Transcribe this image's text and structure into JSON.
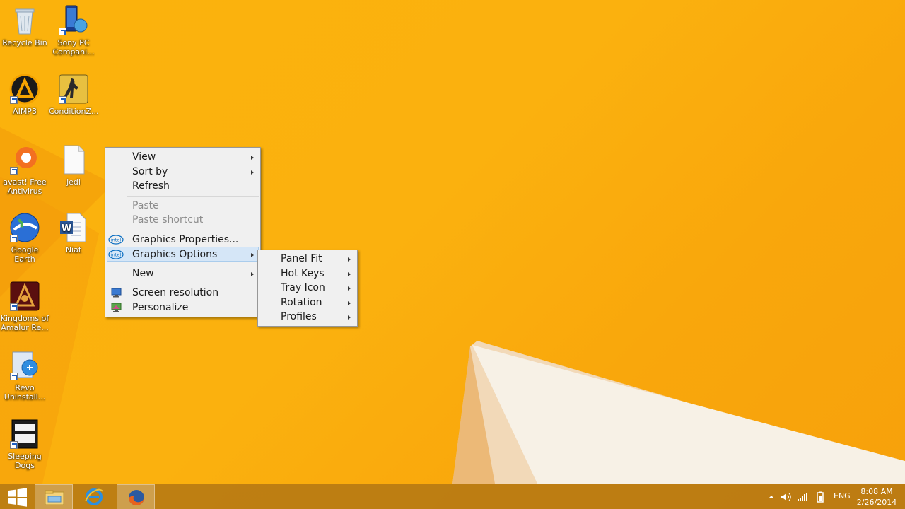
{
  "desktop": {
    "icons": [
      {
        "label": "Recycle Bin"
      },
      {
        "label": "Sony PC Compani..."
      },
      {
        "label": "AIMP3"
      },
      {
        "label": "ConditionZ..."
      },
      {
        "label": "avast! Free Antivirus"
      },
      {
        "label": "jedi"
      },
      {
        "label": "Google Earth"
      },
      {
        "label": "Niat"
      },
      {
        "label": "Kingdoms of Amalur Re..."
      },
      {
        "label": "Revo Uninstall..."
      },
      {
        "label": "Sleeping Dogs"
      }
    ]
  },
  "context_menu": {
    "items": [
      {
        "label": "View"
      },
      {
        "label": "Sort by"
      },
      {
        "label": "Refresh"
      },
      {
        "label": "Paste"
      },
      {
        "label": "Paste shortcut"
      },
      {
        "label": "Graphics Properties..."
      },
      {
        "label": "Graphics Options"
      },
      {
        "label": "New"
      },
      {
        "label": "Screen resolution"
      },
      {
        "label": "Personalize"
      }
    ],
    "icon_text": "intel"
  },
  "submenu": {
    "items": [
      {
        "label": "Panel Fit"
      },
      {
        "label": "Hot Keys"
      },
      {
        "label": "Tray Icon"
      },
      {
        "label": "Rotation"
      },
      {
        "label": "Profiles"
      }
    ]
  },
  "taskbar": {
    "language": "ENG",
    "time": "8:08 AM",
    "date": "2/26/2014",
    "colors": {
      "accent": "#fbb20c",
      "menu_highlight": "#d5e6f7"
    }
  }
}
